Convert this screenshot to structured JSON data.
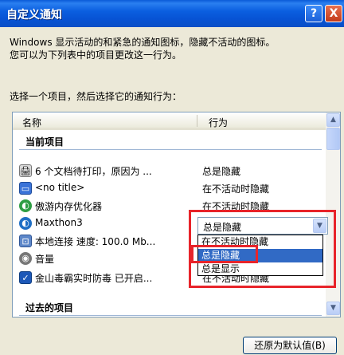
{
  "window": {
    "title": "自定义通知"
  },
  "titlebar": {
    "help_label": "?",
    "close_label": "X"
  },
  "description": {
    "line1": "Windows 显示活动的和紧急的通知图标，隐藏不活动的图标。",
    "line2": "您可以为下列表中的项目更改这一行为。"
  },
  "instruction": "选择一个项目，然后选择它的通知行为：",
  "columns": {
    "name": "名称",
    "action": "行为"
  },
  "groups": {
    "current": "当前项目",
    "past": "过去的项目"
  },
  "rows": [
    {
      "name": "6 个文档待打印，原因为 ...",
      "action": "总是隐藏",
      "icon": "printer-icon"
    },
    {
      "name": "<no title>",
      "action": "在不活动时隐藏",
      "icon": "window-icon"
    },
    {
      "name": "傲游内存优化器",
      "action": "在不活动时隐藏",
      "icon": "maxthon-icon"
    },
    {
      "name": "Maxthon3",
      "action": "",
      "icon": "maxthon-icon"
    },
    {
      "name": "本地连接 速度: 100.0 Mb...",
      "action": "",
      "icon": "network-icon"
    },
    {
      "name": "音量",
      "action": "",
      "icon": "speaker-icon"
    },
    {
      "name": "金山毒霸实时防毒 已开启...",
      "action": "在不活动时隐藏",
      "icon": "antivirus-icon"
    }
  ],
  "combo": {
    "value": "总是隐藏"
  },
  "dropdown": {
    "options": [
      "在不活动时隐藏",
      "总是隐藏",
      "总是显示"
    ],
    "selected": "总是隐藏"
  },
  "restore_button": "还原为默认值(B)",
  "colors": {
    "highlight": "#e8242a",
    "selection": "#316ac5",
    "titlebar": "#0753d4"
  }
}
